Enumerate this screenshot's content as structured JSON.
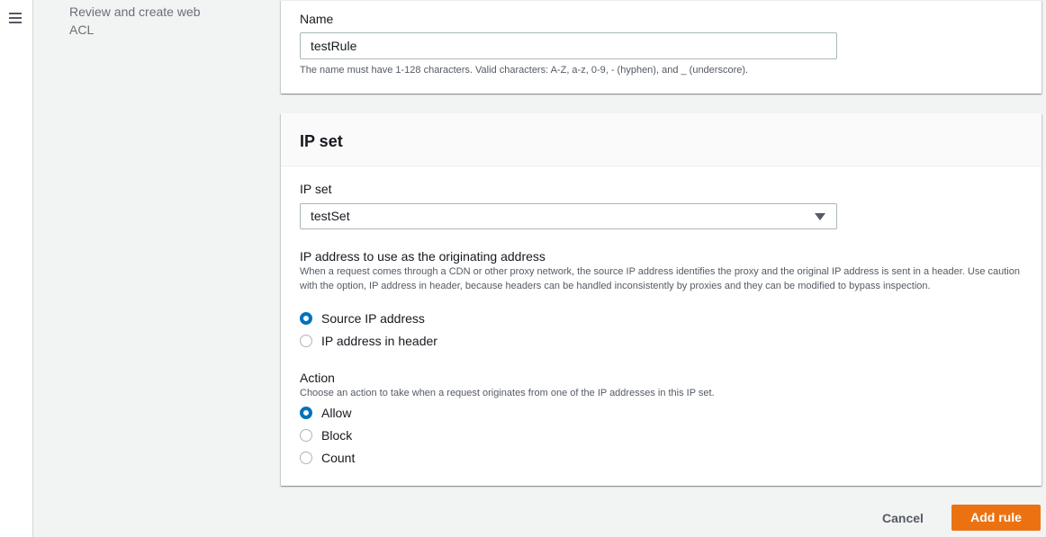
{
  "side_nav": {
    "item_review": "Review and create web ACL"
  },
  "name_section": {
    "label": "Name",
    "value": "testRule",
    "hint": "The name must have 1-128 characters. Valid characters: A-Z, a-z, 0-9, - (hyphen), and _ (underscore)."
  },
  "ipset_section": {
    "title": "IP set",
    "select_label": "IP set",
    "select_value": "testSet",
    "origin_label": "IP address to use as the originating address",
    "origin_desc": "When a request comes through a CDN or other proxy network, the source IP address identifies the proxy and the original IP address is sent in a header. Use caution with the option, IP address in header, because headers can be handled inconsistently by proxies and they can be modified to bypass inspection.",
    "origin_options": [
      "Source IP address",
      "IP address in header"
    ],
    "origin_selected": "Source IP address",
    "action_label": "Action",
    "action_desc": "Choose an action to take when a request originates from one of the IP addresses in this IP set.",
    "action_options": [
      "Allow",
      "Block",
      "Count"
    ],
    "action_selected": "Allow"
  },
  "footer": {
    "cancel_label": "Cancel",
    "add_label": "Add rule"
  },
  "colors": {
    "primary_button": "#ec7211",
    "radio_selected": "#0073bb"
  },
  "icons": {
    "menu": "hamburger-menu-icon",
    "dropdown": "caret-down-icon"
  }
}
